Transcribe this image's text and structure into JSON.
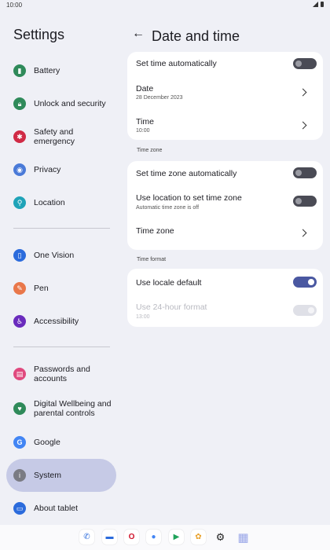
{
  "status_bar": {
    "time": "10:00"
  },
  "sidebar": {
    "title": "Settings",
    "items": [
      {
        "label": "Battery",
        "icon": "battery-icon",
        "color": "#2f8a5a"
      },
      {
        "label": "Unlock and security",
        "icon": "lock-icon",
        "color": "#2f8a5a"
      },
      {
        "label": "Safety and emergency",
        "icon": "asterisk-icon",
        "color": "#d02a45"
      },
      {
        "label": "Privacy",
        "icon": "eye-icon",
        "color": "#4a7ad8"
      },
      {
        "label": "Location",
        "icon": "location-pin-icon",
        "color": "#1fa3b8"
      },
      {
        "label": "One Vision",
        "icon": "one-vision-icon",
        "color": "#2b6bdc"
      },
      {
        "label": "Pen",
        "icon": "pen-icon",
        "color": "#e9774a"
      },
      {
        "label": "Accessibility",
        "icon": "accessibility-icon",
        "color": "#6a2bbd"
      },
      {
        "label": "Passwords and accounts",
        "icon": "key-icon",
        "color": "#e0497e"
      },
      {
        "label": "Digital Wellbeing and parental controls",
        "icon": "wellbeing-icon",
        "color": "#2f8a5a"
      },
      {
        "label": "Google",
        "icon": "google-icon",
        "color": "#4285f4"
      },
      {
        "label": "System",
        "icon": "info-icon",
        "color": "#7a7b83"
      },
      {
        "label": "About tablet",
        "icon": "tablet-icon",
        "color": "#2b6bdc"
      }
    ]
  },
  "header": {
    "title": "Date and time"
  },
  "sections": {
    "time_zone": "Time zone",
    "time_format": "Time format"
  },
  "rows": {
    "set_time_auto": {
      "title": "Set time automatically",
      "enabled": false
    },
    "date": {
      "title": "Date",
      "value": "28 December 2023"
    },
    "time": {
      "title": "Time",
      "value": "10:00"
    },
    "set_tz_auto": {
      "title": "Set time zone automatically",
      "enabled": false
    },
    "use_location_tz": {
      "title": "Use location to set time zone",
      "subtitle": "Automatic time zone is off",
      "enabled": false
    },
    "time_zone": {
      "title": "Time zone"
    },
    "locale_default": {
      "title": "Use locale default",
      "enabled": true
    },
    "h24": {
      "title": "Use 24-hour format",
      "subtitle": "13:00",
      "enabled": true,
      "disabled": true
    }
  },
  "dock": [
    {
      "icon": "phone-icon",
      "glyph": "✆",
      "color": "#2b6bdc"
    },
    {
      "icon": "messages-icon",
      "glyph": "▬",
      "color": "#2b6bdc"
    },
    {
      "icon": "opera-icon",
      "glyph": "O",
      "color": "#d0122a"
    },
    {
      "icon": "assistant-icon",
      "glyph": "●",
      "color": "#4285f4"
    },
    {
      "icon": "play-store-icon",
      "glyph": "▶",
      "color": "#1fa35a"
    },
    {
      "icon": "photos-icon",
      "glyph": "✿",
      "color": "#e9a12b"
    },
    {
      "icon": "settings-gear-icon",
      "glyph": "⚙",
      "color": "#222222"
    },
    {
      "icon": "app-grid-icon",
      "glyph": "▦",
      "color": "#9aa6e8"
    }
  ]
}
